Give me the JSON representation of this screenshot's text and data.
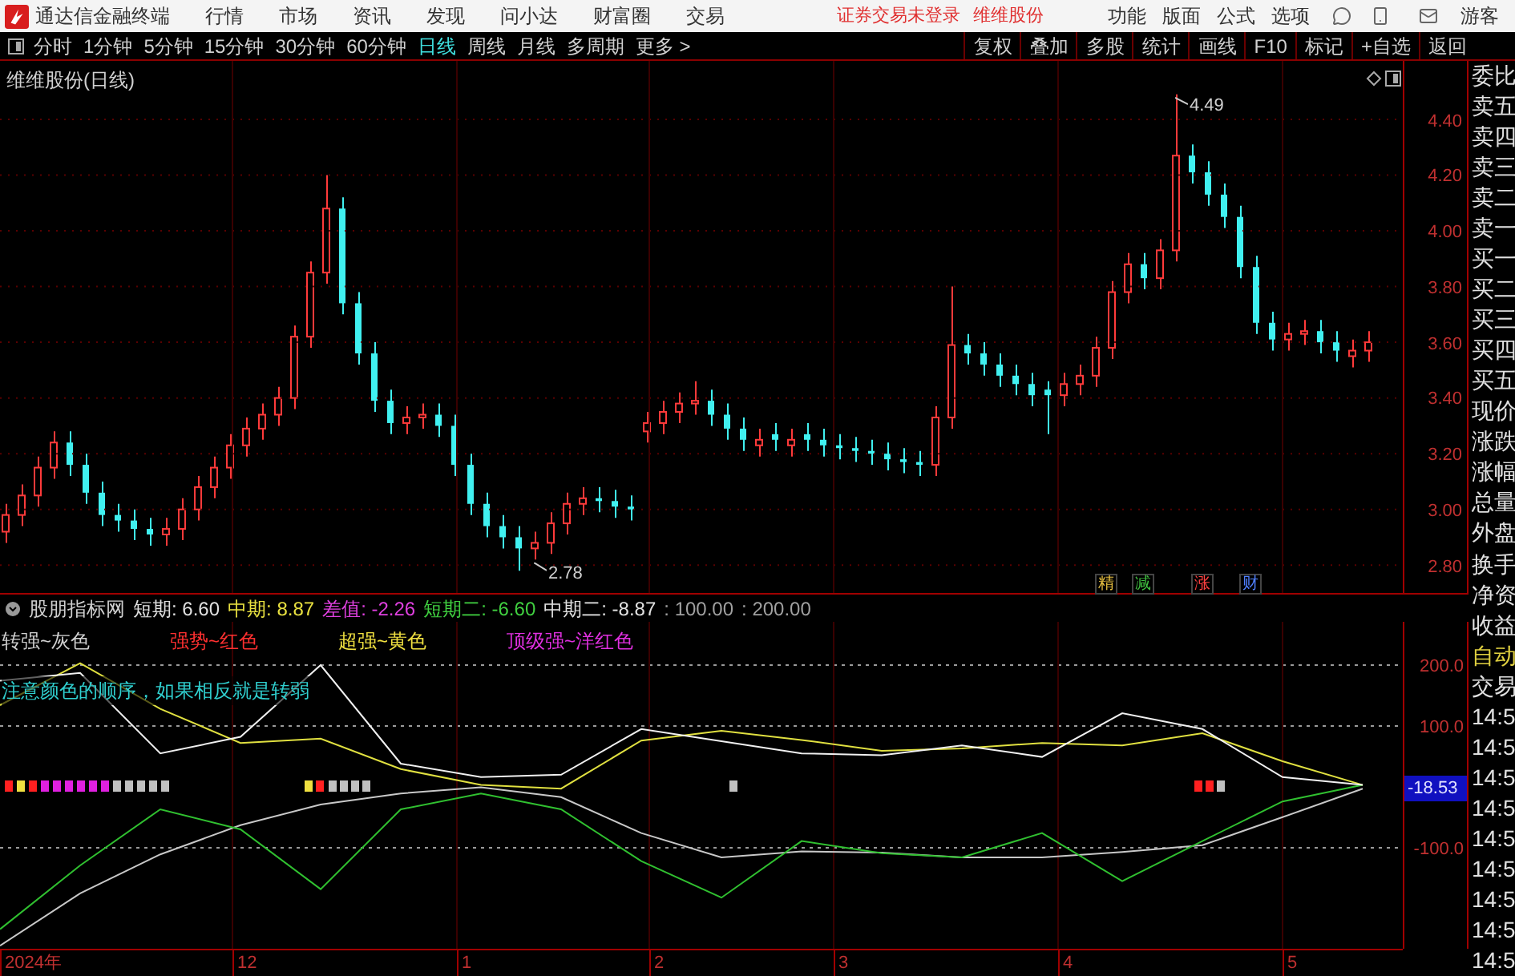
{
  "menubar": {
    "app_title": "通达信金融终端",
    "menus": [
      "行情",
      "市场",
      "资讯",
      "发现",
      "问小达",
      "财富圈",
      "交易"
    ],
    "status_texts": [
      "证券交易未登录",
      "维维股份"
    ],
    "right_menus": [
      "功能",
      "版面",
      "公式",
      "选项"
    ],
    "user": "游客"
  },
  "period_tabs": [
    {
      "label": "分时",
      "selected": false
    },
    {
      "label": "1分钟",
      "selected": false
    },
    {
      "label": "5分钟",
      "selected": false
    },
    {
      "label": "15分钟",
      "selected": false
    },
    {
      "label": "30分钟",
      "selected": false
    },
    {
      "label": "60分钟",
      "selected": false
    },
    {
      "label": "日线",
      "selected": true
    },
    {
      "label": "周线",
      "selected": false
    },
    {
      "label": "月线",
      "selected": false
    },
    {
      "label": "多周期",
      "selected": false
    },
    {
      "label": "更多 >",
      "selected": false
    }
  ],
  "toolbar_buttons": [
    "复权",
    "叠加",
    "多股",
    "统计",
    "画线",
    "F10",
    "标记",
    "+自选",
    "返回"
  ],
  "price_chart": {
    "title": "维维股份(日线)",
    "high_label": "4.49",
    "low_label": "2.78",
    "chart_data": {
      "type": "candlestick",
      "grid": true,
      "ylim": [
        2.7,
        4.61
      ],
      "yticks": [
        {
          "value": 4.4,
          "label": "4.40"
        },
        {
          "value": 4.2,
          "label": "4.20"
        },
        {
          "value": 4.0,
          "label": "4.00"
        },
        {
          "value": 3.8,
          "label": "3.80"
        },
        {
          "value": 3.6,
          "label": "3.60"
        },
        {
          "value": 3.4,
          "label": "3.40"
        },
        {
          "value": 3.2,
          "label": "3.20"
        },
        {
          "value": 3.0,
          "label": "3.00"
        },
        {
          "value": 2.8,
          "label": "2.80"
        }
      ],
      "ohlc": [
        [
          2.92,
          3.02,
          2.88,
          2.98
        ],
        [
          2.98,
          3.09,
          2.94,
          3.05
        ],
        [
          3.05,
          3.19,
          3.01,
          3.15
        ],
        [
          3.15,
          3.28,
          3.11,
          3.24
        ],
        [
          3.24,
          3.28,
          3.12,
          3.16
        ],
        [
          3.16,
          3.2,
          3.02,
          3.06
        ],
        [
          3.06,
          3.1,
          2.94,
          2.98
        ],
        [
          2.98,
          3.02,
          2.92,
          2.96
        ],
        [
          2.96,
          3.0,
          2.89,
          2.93
        ],
        [
          2.93,
          2.97,
          2.87,
          2.91
        ],
        [
          2.91,
          2.97,
          2.87,
          2.93
        ],
        [
          2.93,
          3.04,
          2.89,
          3.0
        ],
        [
          3.0,
          3.12,
          2.96,
          3.08
        ],
        [
          3.08,
          3.19,
          3.04,
          3.15
        ],
        [
          3.15,
          3.27,
          3.11,
          3.23
        ],
        [
          3.23,
          3.33,
          3.19,
          3.29
        ],
        [
          3.29,
          3.38,
          3.25,
          3.34
        ],
        [
          3.34,
          3.44,
          3.3,
          3.4
        ],
        [
          3.4,
          3.66,
          3.36,
          3.62
        ],
        [
          3.62,
          3.89,
          3.58,
          3.85
        ],
        [
          3.85,
          4.2,
          3.81,
          4.08
        ],
        [
          4.08,
          4.12,
          3.7,
          3.74
        ],
        [
          3.74,
          3.78,
          3.52,
          3.56
        ],
        [
          3.56,
          3.6,
          3.35,
          3.39
        ],
        [
          3.39,
          3.43,
          3.27,
          3.31
        ],
        [
          3.31,
          3.37,
          3.27,
          3.33
        ],
        [
          3.33,
          3.38,
          3.29,
          3.34
        ],
        [
          3.34,
          3.38,
          3.26,
          3.3
        ],
        [
          3.3,
          3.34,
          3.12,
          3.16
        ],
        [
          3.16,
          3.2,
          2.98,
          3.02
        ],
        [
          3.02,
          3.06,
          2.9,
          2.94
        ],
        [
          2.94,
          2.98,
          2.86,
          2.9
        ],
        [
          2.9,
          2.94,
          2.78,
          2.86
        ],
        [
          2.86,
          2.92,
          2.82,
          2.88
        ],
        [
          2.88,
          2.99,
          2.84,
          2.95
        ],
        [
          2.95,
          3.06,
          2.91,
          3.02
        ],
        [
          3.02,
          3.08,
          2.98,
          3.04
        ],
        [
          3.04,
          3.08,
          2.99,
          3.03
        ],
        [
          3.03,
          3.07,
          2.97,
          3.01
        ],
        [
          3.01,
          3.05,
          2.96,
          3.0
        ],
        [
          3.28,
          3.35,
          3.24,
          3.31
        ],
        [
          3.31,
          3.39,
          3.27,
          3.35
        ],
        [
          3.35,
          3.42,
          3.31,
          3.38
        ],
        [
          3.38,
          3.46,
          3.34,
          3.39
        ],
        [
          3.39,
          3.43,
          3.3,
          3.34
        ],
        [
          3.34,
          3.38,
          3.25,
          3.29
        ],
        [
          3.29,
          3.33,
          3.21,
          3.25
        ],
        [
          3.23,
          3.29,
          3.19,
          3.25
        ],
        [
          3.27,
          3.31,
          3.21,
          3.25
        ],
        [
          3.23,
          3.29,
          3.19,
          3.25
        ],
        [
          3.27,
          3.31,
          3.21,
          3.25
        ],
        [
          3.25,
          3.29,
          3.19,
          3.23
        ],
        [
          3.23,
          3.27,
          3.18,
          3.22
        ],
        [
          3.22,
          3.26,
          3.17,
          3.21
        ],
        [
          3.21,
          3.25,
          3.16,
          3.2
        ],
        [
          3.2,
          3.24,
          3.14,
          3.18
        ],
        [
          3.18,
          3.22,
          3.13,
          3.17
        ],
        [
          3.17,
          3.21,
          3.12,
          3.16
        ],
        [
          3.16,
          3.37,
          3.12,
          3.33
        ],
        [
          3.33,
          3.8,
          3.29,
          3.59
        ],
        [
          3.59,
          3.63,
          3.52,
          3.56
        ],
        [
          3.56,
          3.6,
          3.48,
          3.52
        ],
        [
          3.52,
          3.56,
          3.44,
          3.48
        ],
        [
          3.48,
          3.52,
          3.41,
          3.45
        ],
        [
          3.45,
          3.49,
          3.37,
          3.41
        ],
        [
          3.43,
          3.46,
          3.27,
          3.41
        ],
        [
          3.41,
          3.49,
          3.37,
          3.45
        ],
        [
          3.45,
          3.52,
          3.41,
          3.48
        ],
        [
          3.48,
          3.62,
          3.44,
          3.58
        ],
        [
          3.58,
          3.82,
          3.54,
          3.78
        ],
        [
          3.78,
          3.92,
          3.74,
          3.88
        ],
        [
          3.88,
          3.92,
          3.79,
          3.83
        ],
        [
          3.83,
          3.97,
          3.79,
          3.93
        ],
        [
          3.93,
          4.49,
          3.89,
          4.27
        ],
        [
          4.27,
          4.31,
          4.17,
          4.21
        ],
        [
          4.21,
          4.25,
          4.09,
          4.13
        ],
        [
          4.13,
          4.17,
          4.01,
          4.05
        ],
        [
          4.05,
          4.09,
          3.83,
          3.87
        ],
        [
          3.87,
          3.91,
          3.63,
          3.67
        ],
        [
          3.67,
          3.71,
          3.57,
          3.61
        ],
        [
          3.61,
          3.67,
          3.57,
          3.63
        ],
        [
          3.63,
          3.68,
          3.59,
          3.64
        ],
        [
          3.64,
          3.68,
          3.56,
          3.6
        ],
        [
          3.6,
          3.64,
          3.53,
          3.57
        ],
        [
          3.55,
          3.61,
          3.51,
          3.57
        ],
        [
          3.57,
          3.64,
          3.53,
          3.6
        ]
      ]
    },
    "tags": [
      {
        "text": "精",
        "color": "#e8c040"
      },
      {
        "text": "减",
        "color": "#40c040"
      },
      {
        "text": "涨",
        "color": "#ff4040"
      },
      {
        "text": "财",
        "color": "#5080ff"
      }
    ]
  },
  "indicator": {
    "name": "股朋指标网",
    "values": [
      {
        "text": "短期: 6.60",
        "color": "#e0e0e0"
      },
      {
        "text": "中期: 8.87",
        "color": "#e8e040"
      },
      {
        "text": "差值: -2.26",
        "color": "#e040e0"
      },
      {
        "text": "短期二: -6.60",
        "color": "#40d040"
      },
      {
        "text": "中期二: -8.87",
        "color": "#e0e0e0"
      },
      {
        "text": ": 100.00",
        "color": "#a0a0a0"
      },
      {
        "text": ": 200.00",
        "color": "#a0a0a0"
      }
    ],
    "legend": [
      {
        "text": "转强~灰色",
        "color": "#d0d0d0"
      },
      {
        "text": "强势~红色",
        "color": "#ff3030"
      },
      {
        "text": "超强~黄色",
        "color": "#f0e040"
      },
      {
        "text": "顶级强~洋红色",
        "color": "#e030e0"
      }
    ],
    "note": "注意颜色的顺序，如果相反就是转弱",
    "chart_data": {
      "type": "line",
      "grid": true,
      "ylim": [
        -266,
        271
      ],
      "yticks": [
        {
          "value": 200,
          "label": "200.0"
        },
        {
          "value": 100,
          "label": "100.0"
        },
        {
          "value": -100,
          "label": "-100.0"
        }
      ],
      "series": [
        {
          "color": "#c8c8c8",
          "values": [
            -261,
            -175,
            -111,
            -63,
            -29,
            -11,
            -1,
            -17,
            -76,
            -116,
            -106,
            -108,
            -116,
            -116,
            -107,
            -96,
            -50,
            -3
          ]
        },
        {
          "color": "#30c030",
          "values": [
            -234,
            -129,
            -37,
            -70,
            -168,
            -37,
            -11,
            -37,
            -122,
            -182,
            -89,
            -109,
            -116,
            -76,
            -155,
            -89,
            -24,
            3
          ]
        },
        {
          "color": "#e0e040",
          "values": [
            134,
            203,
            128,
            72,
            79,
            29,
            3,
            -3,
            76,
            92,
            77,
            59,
            63,
            72,
            68,
            88,
            42,
            3
          ]
        },
        {
          "color": "#f0f0f0",
          "values": [
            174,
            187,
            55,
            82,
            200,
            38,
            16,
            20,
            95,
            75,
            55,
            52,
            68,
            49,
            121,
            95,
            16,
            3
          ]
        }
      ]
    },
    "current_value": "-18.53"
  },
  "date_axis": [
    "2024年",
    "12",
    "1",
    "2",
    "3",
    "4",
    "5"
  ],
  "quote_panel": [
    {
      "text": "委比",
      "kind": "label"
    },
    {
      "text": "卖五",
      "kind": "label"
    },
    {
      "text": "卖四",
      "kind": "label"
    },
    {
      "text": "卖三",
      "kind": "label"
    },
    {
      "text": "卖二",
      "kind": "label"
    },
    {
      "text": "卖一",
      "kind": "label"
    },
    {
      "text": "买一",
      "kind": "label"
    },
    {
      "text": "买二",
      "kind": "label"
    },
    {
      "text": "买三",
      "kind": "label"
    },
    {
      "text": "买四",
      "kind": "label"
    },
    {
      "text": "买五",
      "kind": "label"
    },
    {
      "text": "现价",
      "kind": "label"
    },
    {
      "text": "涨跌",
      "kind": "label"
    },
    {
      "text": "涨幅",
      "kind": "label"
    },
    {
      "text": "总量",
      "kind": "label"
    },
    {
      "text": "外盘",
      "kind": "label"
    },
    {
      "text": "换手",
      "kind": "label"
    },
    {
      "text": "净资",
      "kind": "label"
    },
    {
      "text": "收益",
      "kind": "label"
    },
    {
      "text": "自动",
      "kind": "action"
    },
    {
      "text": "交易",
      "kind": "label"
    },
    {
      "text": "14:5",
      "kind": "time"
    },
    {
      "text": "14:5",
      "kind": "time"
    },
    {
      "text": "14:5",
      "kind": "time"
    },
    {
      "text": "14:5",
      "kind": "time"
    },
    {
      "text": "14:5",
      "kind": "time"
    },
    {
      "text": "14:5",
      "kind": "time"
    },
    {
      "text": "14:5",
      "kind": "time"
    },
    {
      "text": "14:5",
      "kind": "time"
    },
    {
      "text": "14:5",
      "kind": "time"
    }
  ]
}
